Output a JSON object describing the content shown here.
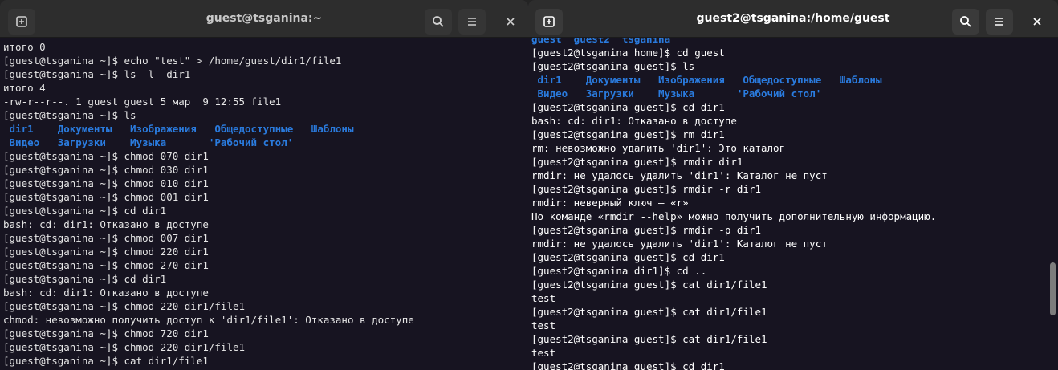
{
  "left_window": {
    "title": "guest@tsganina:~",
    "icons": {
      "new_tab": "new-tab-icon",
      "search": "search-icon",
      "menu": "hamburger-menu-icon",
      "close": "close-icon"
    },
    "lines": [
      {
        "text": "итого 0",
        "kind": "normal"
      },
      {
        "text": "[guest@tsganina ~]$ echo \"test\" > /home/guest/dir1/file1",
        "kind": "normal"
      },
      {
        "text": "[guest@tsganina ~]$ ls -l  dir1",
        "kind": "normal"
      },
      {
        "text": "итого 4",
        "kind": "normal"
      },
      {
        "text": "-rw-r--r--. 1 guest guest 5 мар  9 12:55 file1",
        "kind": "normal"
      },
      {
        "text": "[guest@tsganina ~]$ ls",
        "kind": "normal"
      },
      {
        "text": " dir1    Документы   Изображения   Общедоступные   Шаблоны",
        "kind": "dir"
      },
      {
        "text": " Видео   Загрузки    Музыка       'Рабочий стол'",
        "kind": "dir"
      },
      {
        "text": "[guest@tsganina ~]$ chmod 070 dir1",
        "kind": "normal"
      },
      {
        "text": "[guest@tsganina ~]$ chmod 030 dir1",
        "kind": "normal"
      },
      {
        "text": "[guest@tsganina ~]$ chmod 010 dir1",
        "kind": "normal"
      },
      {
        "text": "[guest@tsganina ~]$ chmod 001 dir1",
        "kind": "normal"
      },
      {
        "text": "[guest@tsganina ~]$ cd dir1",
        "kind": "normal"
      },
      {
        "text": "bash: cd: dir1: Отказано в доступе",
        "kind": "normal"
      },
      {
        "text": "[guest@tsganina ~]$ chmod 007 dir1",
        "kind": "normal"
      },
      {
        "text": "[guest@tsganina ~]$ chmod 220 dir1",
        "kind": "normal"
      },
      {
        "text": "[guest@tsganina ~]$ chmod 270 dir1",
        "kind": "normal"
      },
      {
        "text": "[guest@tsganina ~]$ cd dir1",
        "kind": "normal"
      },
      {
        "text": "bash: cd: dir1: Отказано в доступе",
        "kind": "normal"
      },
      {
        "text": "[guest@tsganina ~]$ chmod 220 dir1/file1",
        "kind": "normal"
      },
      {
        "text": "chmod: невозможно получить доступ к 'dir1/file1': Отказано в доступе",
        "kind": "normal"
      },
      {
        "text": "[guest@tsganina ~]$ chmod 720 dir1",
        "kind": "normal"
      },
      {
        "text": "[guest@tsganina ~]$ chmod 220 dir1/file1",
        "kind": "normal"
      },
      {
        "text": "[guest@tsganina ~]$ cat dir1/file1",
        "kind": "normal"
      }
    ]
  },
  "right_window": {
    "title": "guest2@tsganina:/home/guest",
    "icons": {
      "new_tab": "new-tab-icon",
      "search": "search-icon",
      "menu": "hamburger-menu-icon",
      "close": "close-icon"
    },
    "lines": [
      {
        "text": "guest  guest2  tsganina",
        "kind": "dir"
      },
      {
        "text": "[guest2@tsganina home]$ cd guest",
        "kind": "normal"
      },
      {
        "text": "[guest2@tsganina guest]$ ls",
        "kind": "normal"
      },
      {
        "text": " dir1    Документы   Изображения   Общедоступные   Шаблоны",
        "kind": "dir"
      },
      {
        "text": " Видео   Загрузки    Музыка       'Рабочий стол'",
        "kind": "dir"
      },
      {
        "text": "[guest2@tsganina guest]$ cd dir1",
        "kind": "normal"
      },
      {
        "text": "bash: cd: dir1: Отказано в доступе",
        "kind": "normal"
      },
      {
        "text": "[guest2@tsganina guest]$ rm dir1",
        "kind": "normal"
      },
      {
        "text": "rm: невозможно удалить 'dir1': Это каталог",
        "kind": "normal"
      },
      {
        "text": "[guest2@tsganina guest]$ rmdir dir1",
        "kind": "normal"
      },
      {
        "text": "rmdir: не удалось удалить 'dir1': Каталог не пуст",
        "kind": "normal"
      },
      {
        "text": "[guest2@tsganina guest]$ rmdir -r dir1",
        "kind": "normal"
      },
      {
        "text": "rmdir: неверный ключ — «r»",
        "kind": "normal"
      },
      {
        "text": "По команде «rmdir --help» можно получить дополнительную информацию.",
        "kind": "normal"
      },
      {
        "text": "[guest2@tsganina guest]$ rmdir -p dir1",
        "kind": "normal"
      },
      {
        "text": "rmdir: не удалось удалить 'dir1': Каталог не пуст",
        "kind": "normal"
      },
      {
        "text": "[guest2@tsganina guest]$ cd dir1",
        "kind": "normal"
      },
      {
        "text": "[guest2@tsganina dir1]$ cd ..",
        "kind": "normal"
      },
      {
        "text": "[guest2@tsganina guest]$ cat dir1/file1",
        "kind": "normal"
      },
      {
        "text": "test",
        "kind": "normal"
      },
      {
        "text": "[guest2@tsganina guest]$ cat dir1/file1",
        "kind": "normal"
      },
      {
        "text": "test",
        "kind": "normal"
      },
      {
        "text": "[guest2@tsganina guest]$ cat dir1/file1",
        "kind": "normal"
      },
      {
        "text": "test",
        "kind": "normal"
      },
      {
        "text": "[guest2@tsganina guest]$ cd dir1",
        "kind": "normal"
      }
    ]
  },
  "colors": {
    "terminal_bg": "#171421",
    "headerbar_bg": "#2d2d2d",
    "text": "#ffffff",
    "directory": "#2a7bde"
  }
}
